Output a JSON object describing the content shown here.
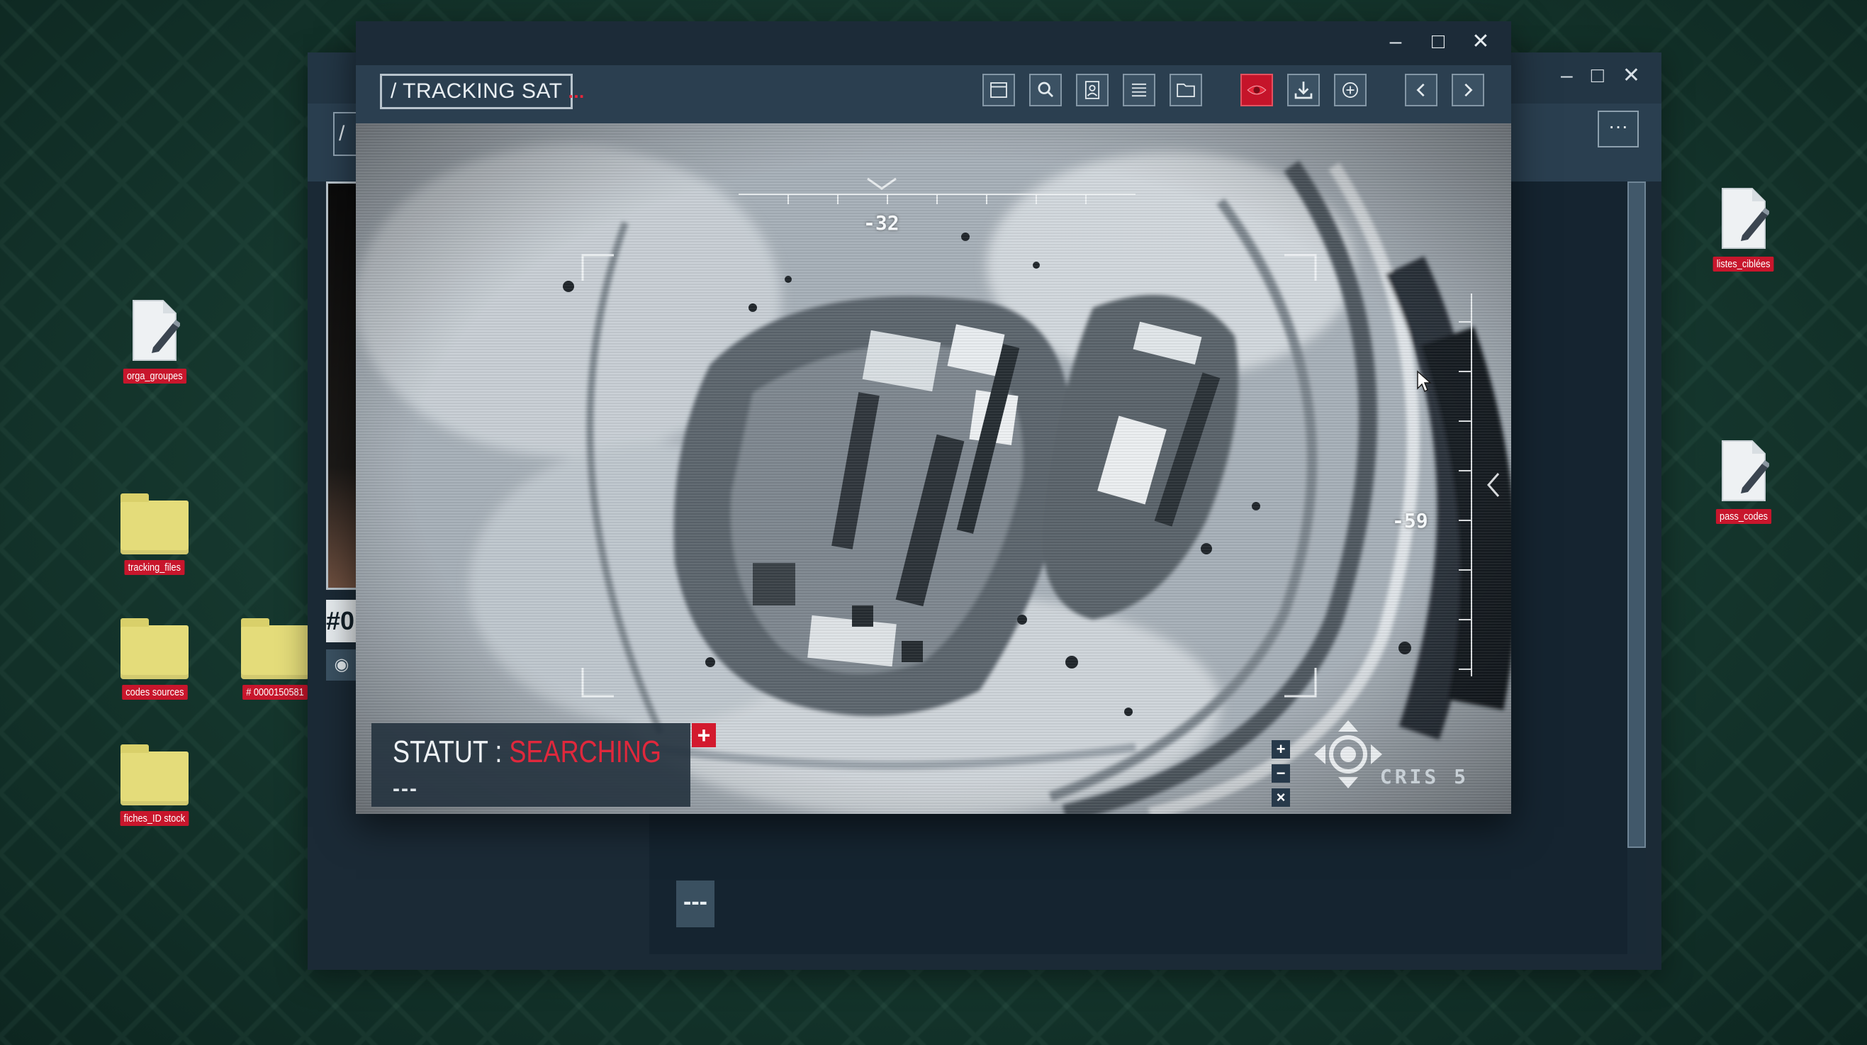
{
  "desktop": {
    "icons": [
      {
        "label": "orga_groupes",
        "type": "doc"
      },
      {
        "label": "tracking_files",
        "type": "folder"
      },
      {
        "label": "codes sources",
        "type": "folder"
      },
      {
        "label": "# 0000150581",
        "type": "folder"
      },
      {
        "label": "fiches_ID stock",
        "type": "folder"
      },
      {
        "label": "listes_ciblées",
        "type": "doc"
      },
      {
        "label": "pass_codes",
        "type": "doc"
      }
    ]
  },
  "back_window": {
    "crumb": "/",
    "more_label": "···",
    "photo_id": "#0",
    "bottom_button_label": "---"
  },
  "main_window": {
    "title": "/ TRACKING SAT",
    "title_dots": "...",
    "status": {
      "label": "STATUT : ",
      "value": "SEARCHING",
      "sub": "---"
    },
    "readouts": {
      "heading": "-32",
      "range": "-59",
      "sensor": "CRIS 5"
    },
    "zoom": {
      "plus": "+",
      "minus": "−",
      "reset": "×"
    }
  },
  "colors": {
    "accent": "#c5142a",
    "status_red": "#e0283c",
    "folder": "#e4dc7a",
    "label_bg": "#c8162c"
  }
}
